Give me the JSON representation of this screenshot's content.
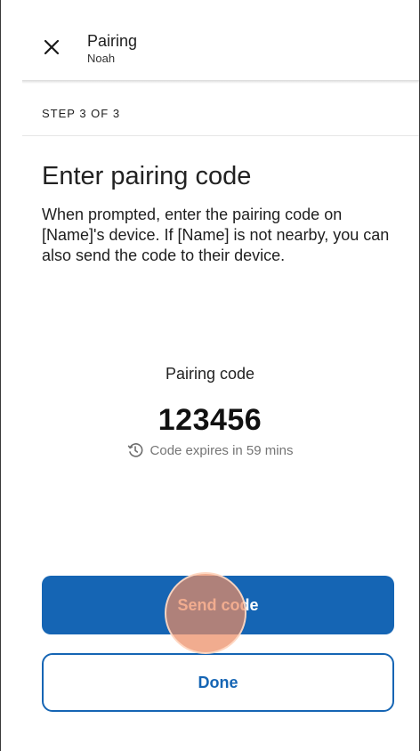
{
  "header": {
    "title": "Pairing",
    "subtitle": "Noah",
    "close_icon": "close-icon"
  },
  "step": {
    "label": "STEP 3 OF 3"
  },
  "content": {
    "title": "Enter pairing code",
    "description": "When prompted, enter the pairing code on [Name]'s device. If [Name] is not nearby, you can also send the code to their device."
  },
  "code": {
    "label": "Pairing code",
    "value": "123456",
    "expiry_text": "Code expires in 59 mins",
    "expiry_icon": "clock-history-icon"
  },
  "actions": {
    "send_label": "Send code",
    "done_label": "Done"
  },
  "colors": {
    "primary": "#1565b4",
    "touch_indicator": "#eb8c64"
  }
}
